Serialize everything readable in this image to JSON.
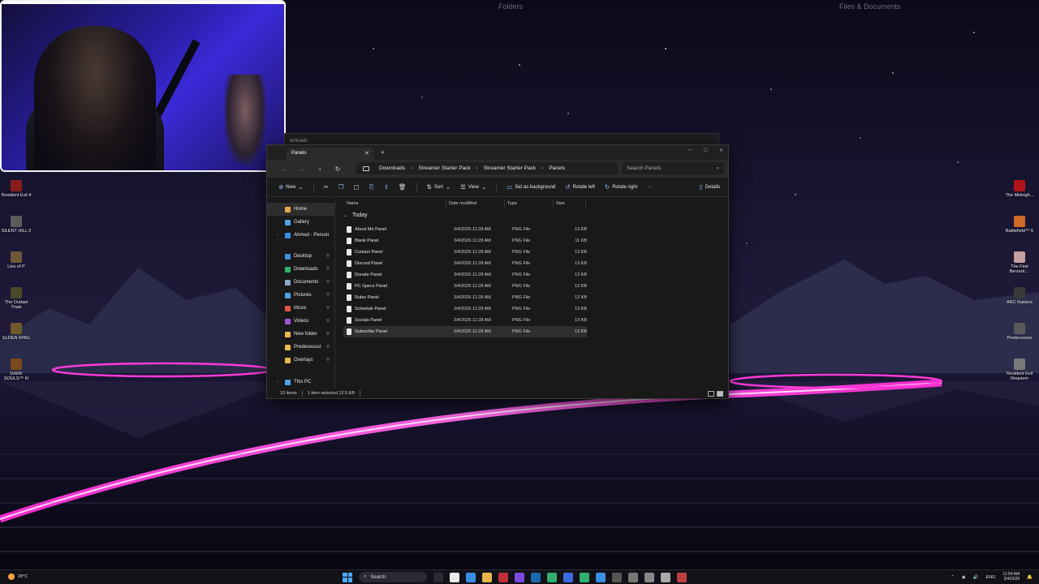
{
  "wallpaper": {
    "labels": [
      "Folders",
      "Files & Documents"
    ]
  },
  "desktop_icons_left": [
    {
      "label": "Resident Evil 4",
      "color": "#8a1c1c"
    },
    {
      "label": "SILENT HILL 2",
      "color": "#5c5c5c"
    },
    {
      "label": "Lies of P",
      "color": "#6b5a3a"
    },
    {
      "label": "The Outlast Trials",
      "color": "#4a4a2a"
    },
    {
      "label": "ELDEN RING",
      "color": "#6e5a2a"
    },
    {
      "label": "DARK SOULS™ III",
      "color": "#7a4a1a"
    }
  ],
  "desktop_icons_right": [
    {
      "label": "The Midnigh...",
      "color": "#b0141a"
    },
    {
      "label": "Battlefield™ 6",
      "color": "#d06a2a"
    },
    {
      "label": "The First Berserk:...",
      "color": "#c7a0a0"
    },
    {
      "label": "ARC Raiders",
      "color": "#3a3a3a"
    },
    {
      "label": "Predecessor",
      "color": "#5a5a5a"
    },
    {
      "label": "Resident Evil Requiem",
      "color": "#7a7a7a"
    }
  ],
  "ghost_window": {
    "title": "wnloads"
  },
  "explorer": {
    "tab_title": "Panels",
    "tab_close": "✕",
    "tab_new": "+",
    "window_controls": [
      "—",
      "☐",
      "✕"
    ],
    "nav": {
      "back": "←",
      "forward": "→",
      "up": "↑",
      "refresh": "↻"
    },
    "breadcrumb": [
      "Downloads",
      "Streamer Starter Pack",
      "Streamer Starter Pack",
      "Panels"
    ],
    "breadcrumb_sep": "›",
    "search_placeholder": "Search Panels",
    "search_icon": "⌕",
    "commands": {
      "new": "New",
      "sort": "Sort",
      "view": "View",
      "set_background": "Set as background",
      "rotate_left": "Rotate left",
      "rotate_right": "Rotate right",
      "more": "···",
      "details": "Details"
    },
    "sidebar": {
      "top": [
        {
          "label": "Home",
          "icon_color": "#e6a94a",
          "active": true
        },
        {
          "label": "Gallery",
          "icon_color": "#4fa3e8",
          "active": false
        },
        {
          "label": "Ahmed - Person",
          "icon_color": "#3a8ee6",
          "active": false,
          "chevron": "›"
        }
      ],
      "pinned": [
        {
          "label": "Desktop",
          "icon_color": "#3f8fe0"
        },
        {
          "label": "Downloads",
          "icon_color": "#2fb06e"
        },
        {
          "label": "Documents",
          "icon_color": "#8aa7c8"
        },
        {
          "label": "Pictures",
          "icon_color": "#4fa3e8"
        },
        {
          "label": "Music",
          "icon_color": "#e0583f"
        },
        {
          "label": "Videos",
          "icon_color": "#9a5ad6"
        },
        {
          "label": "New folder",
          "icon_color": "#e8b84a"
        },
        {
          "label": "Predecessor",
          "icon_color": "#e8b84a"
        },
        {
          "label": "Overlays",
          "icon_color": "#e8b84a"
        }
      ],
      "pin_glyph": "📌",
      "bottom": {
        "label": "This PC",
        "icon_color": "#4fa3e8"
      }
    },
    "columns": [
      "Name",
      "Date modified",
      "Type",
      "Size"
    ],
    "group": "Today",
    "files": [
      {
        "name": "About Me Panel",
        "date": "3/4/2026 11:28 AM",
        "type": "PNG File",
        "size": "13 KB"
      },
      {
        "name": "Blank Panel",
        "date": "3/4/2026 11:28 AM",
        "type": "PNG File",
        "size": "11 KB"
      },
      {
        "name": "Contact Panel",
        "date": "3/4/2026 11:28 AM",
        "type": "PNG File",
        "size": "13 KB"
      },
      {
        "name": "Discord Panel",
        "date": "3/4/2026 11:28 AM",
        "type": "PNG File",
        "size": "13 KB"
      },
      {
        "name": "Donate Panel",
        "date": "3/4/2026 11:28 AM",
        "type": "PNG File",
        "size": "13 KB"
      },
      {
        "name": "PC Specs Panel",
        "date": "3/4/2026 11:28 AM",
        "type": "PNG File",
        "size": "13 KB"
      },
      {
        "name": "Rules Panel",
        "date": "3/4/2026 11:28 AM",
        "type": "PNG File",
        "size": "12 KB"
      },
      {
        "name": "Schedule Panel",
        "date": "3/4/2026 11:28 AM",
        "type": "PNG File",
        "size": "13 KB"
      },
      {
        "name": "Socials Panel",
        "date": "3/4/2026 11:28 AM",
        "type": "PNG File",
        "size": "13 KB"
      },
      {
        "name": "Subscribe Panel",
        "date": "3/4/2026 11:28 AM",
        "type": "PNG File",
        "size": "13 KB",
        "selected": true
      }
    ],
    "status": {
      "count": "10 items",
      "selected": "1 item selected  12.5 KB"
    }
  },
  "taskbar": {
    "weather_temp": "28°C",
    "weather_desc": "Sunny",
    "search_label": "Search",
    "apps": [
      "#2a2a33",
      "#e8e8e8",
      "#3a8ee6",
      "#e8b84a",
      "#c0303a",
      "#7a4ae0",
      "#1a6ab0",
      "#2fb06e",
      "#3a6ae0",
      "#2fb06e",
      "#3a8ee6",
      "#555",
      "#777",
      "#888",
      "#aaa",
      "#c04040"
    ],
    "tray": {
      "lang": "ENG",
      "time": "11:54 AM",
      "date": "3/4/2026"
    }
  }
}
